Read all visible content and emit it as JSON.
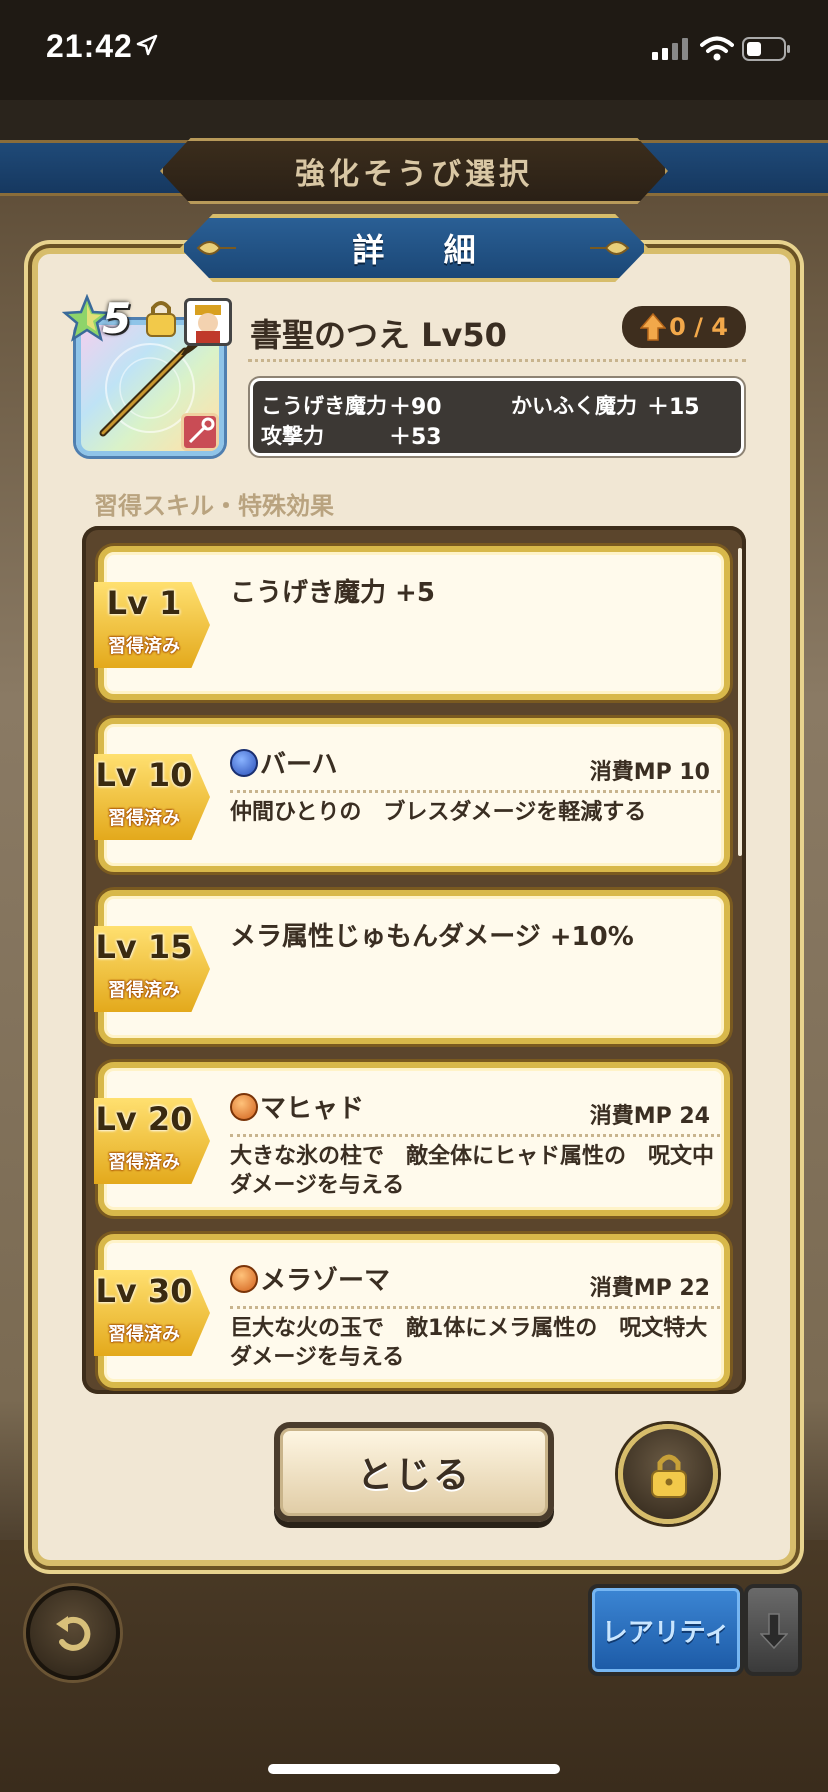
{
  "status_bar": {
    "time": "21:42"
  },
  "screen": {
    "title": "強化そうび選択"
  },
  "dialog": {
    "title": "詳 細",
    "rarity_stars": "5",
    "equipment_name": "書聖のつえ Lv50",
    "upgrade": "0 / 4",
    "stats": [
      {
        "label": "こうげき魔力",
        "value": "＋90"
      },
      {
        "label": "かいふく魔力",
        "value": "＋15"
      },
      {
        "label": "攻撃力",
        "value": "＋53"
      }
    ],
    "section_label": "習得スキル・特殊効果",
    "skills": [
      {
        "level": "Lv 1",
        "status": "習得済み",
        "name": "こうげき魔力 +5",
        "element": "",
        "mp": "",
        "desc": ""
      },
      {
        "level": "Lv 10",
        "status": "習得済み",
        "name": "バーハ",
        "element": "blue",
        "mp": "消費MP 10",
        "desc": "仲間ひとりの　ブレスダメージを軽減する"
      },
      {
        "level": "Lv 15",
        "status": "習得済み",
        "name": "メラ属性じゅもんダメージ +10%",
        "element": "",
        "mp": "",
        "desc": ""
      },
      {
        "level": "Lv 20",
        "status": "習得済み",
        "name": "マヒャド",
        "element": "fire",
        "mp": "消費MP 24",
        "desc": "大きな氷の柱で　敵全体にヒャド属性の　呪文中ダメージを与える"
      },
      {
        "level": "Lv 30",
        "status": "習得済み",
        "name": "メラゾーマ",
        "element": "fire",
        "mp": "消費MP 22",
        "desc": "巨大な火の玉で　敵1体にメラ属性の　呪文特大ダメージを与える"
      }
    ],
    "close_label": "とじる"
  },
  "footer": {
    "rarity_label": "レアリティ"
  },
  "colors": {
    "gold_frame": "#d7bd6b",
    "header_blue": "#1b4776",
    "panel_bg": "#f1e7d4",
    "upgrade_orange": "#f2a84a"
  },
  "icons": [
    "location-arrow-icon",
    "signal-icon",
    "wifi-icon",
    "battery-icon",
    "star-icon",
    "lock-icon",
    "wand-icon",
    "up-arrow-icon",
    "back-arrow-icon",
    "down-arrow-icon"
  ]
}
